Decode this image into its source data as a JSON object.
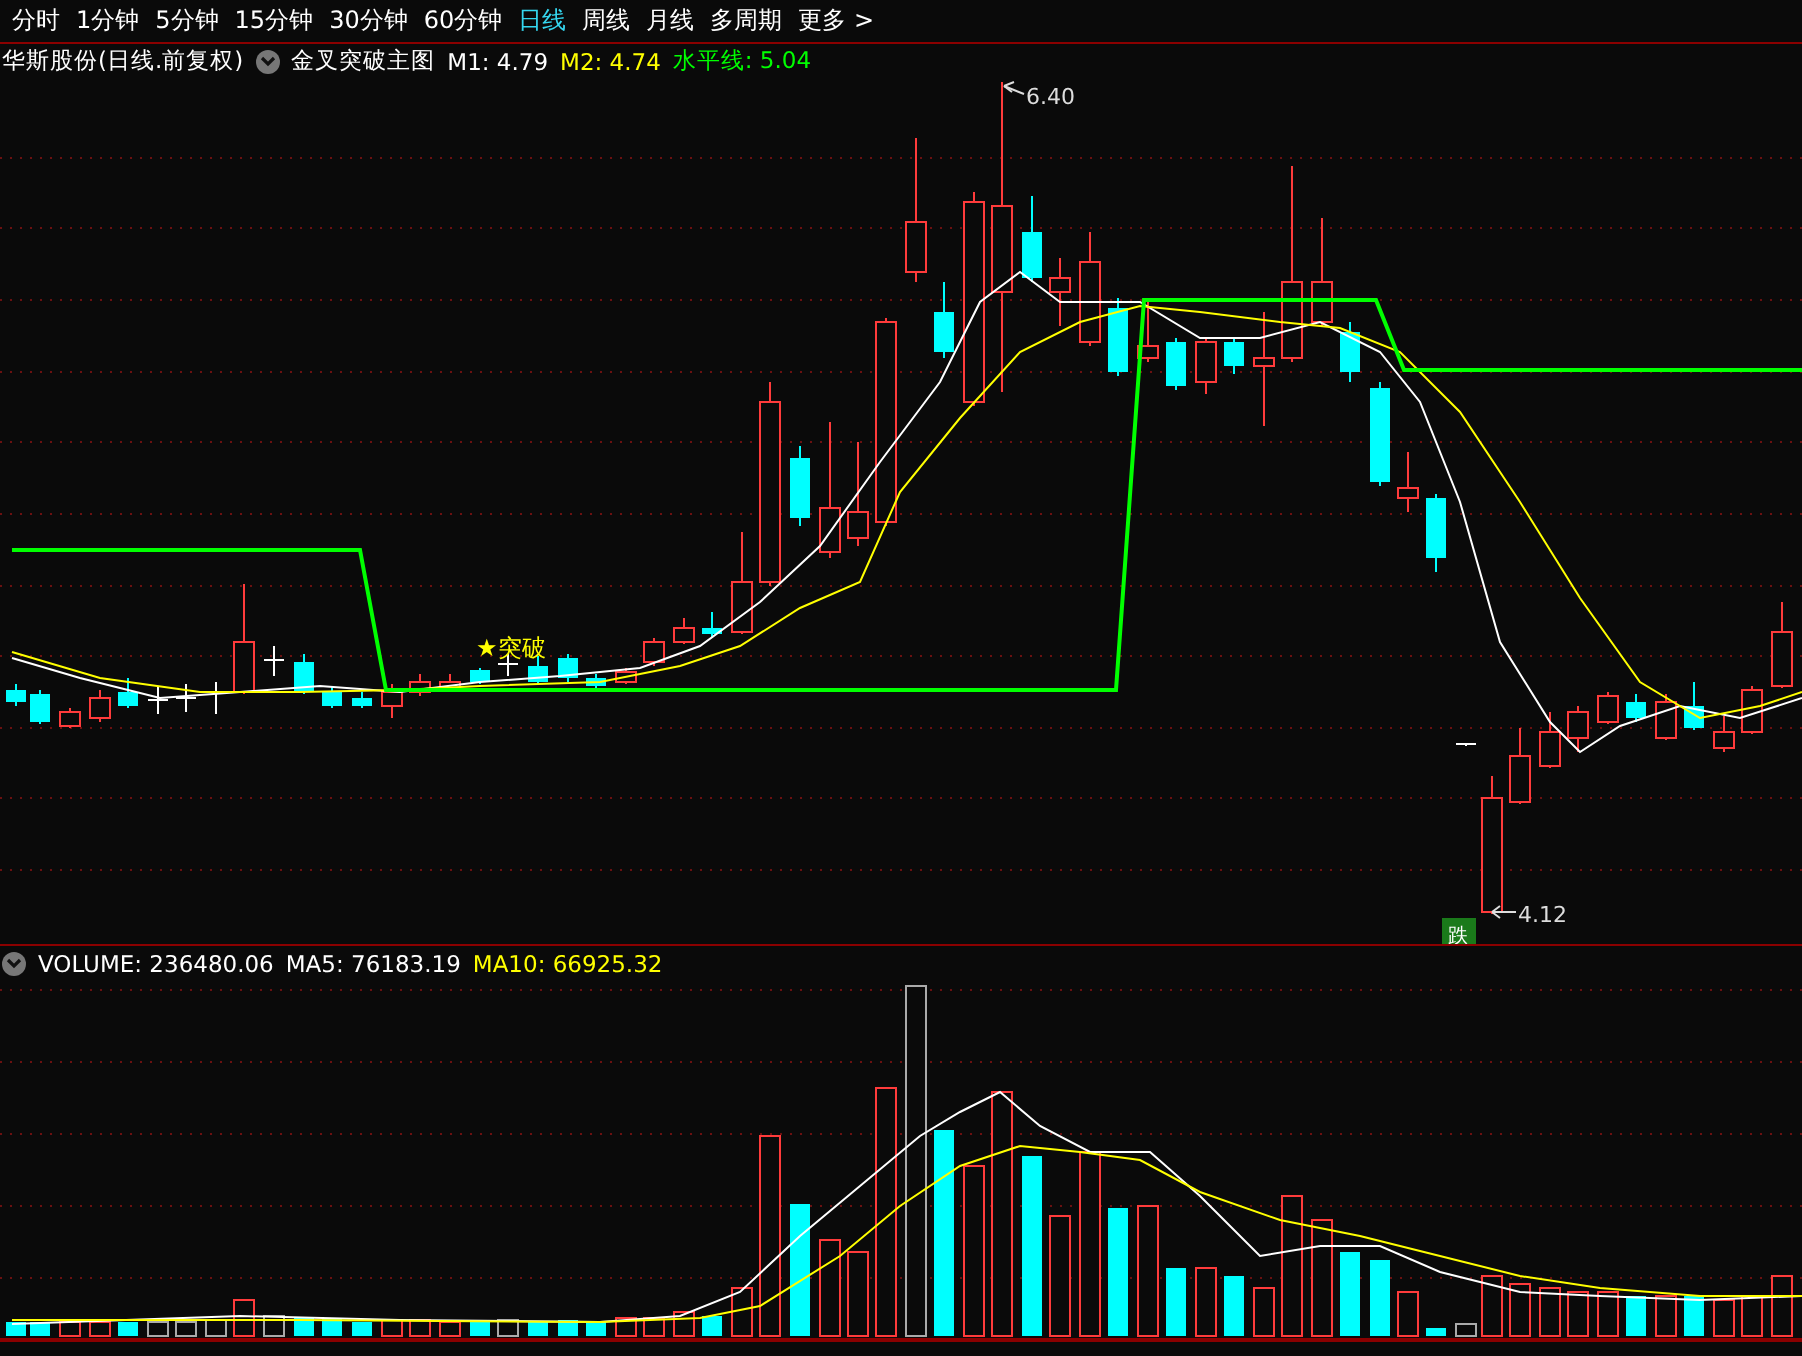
{
  "menu": {
    "tabs": [
      {
        "label": "分时",
        "selected": false
      },
      {
        "label": "1分钟",
        "selected": false
      },
      {
        "label": "5分钟",
        "selected": false
      },
      {
        "label": "15分钟",
        "selected": false
      },
      {
        "label": "30分钟",
        "selected": false
      },
      {
        "label": "60分钟",
        "selected": false
      },
      {
        "label": "日线",
        "selected": true
      },
      {
        "label": "周线",
        "selected": false
      },
      {
        "label": "月线",
        "selected": false
      },
      {
        "label": "多周期",
        "selected": false
      },
      {
        "label": "更多 >",
        "selected": false
      }
    ]
  },
  "price_legend": {
    "stock": "华斯股份(日线.前复权)",
    "indicator": "金叉突破主图",
    "values": [
      {
        "label": "M1: 4.79",
        "color": "#ffffff"
      },
      {
        "label": "M2: 4.74",
        "color": "#ffff00"
      },
      {
        "label": "水平线: 5.04",
        "color": "#00ff00"
      }
    ]
  },
  "price_chart": {
    "high_label": "6.40",
    "low_label": "4.12",
    "signals": [
      {
        "kind": "buy",
        "text": "★突破"
      },
      {
        "kind": "sell",
        "text": "跌"
      }
    ]
  },
  "volume_legend": {
    "values": [
      {
        "label": "VOLUME: 236480.06",
        "color": "#ffffff"
      },
      {
        "label": "MA5: 76183.19",
        "color": "#ffffff"
      },
      {
        "label": "MA10: 66925.32",
        "color": "#ffff00"
      }
    ]
  }
}
